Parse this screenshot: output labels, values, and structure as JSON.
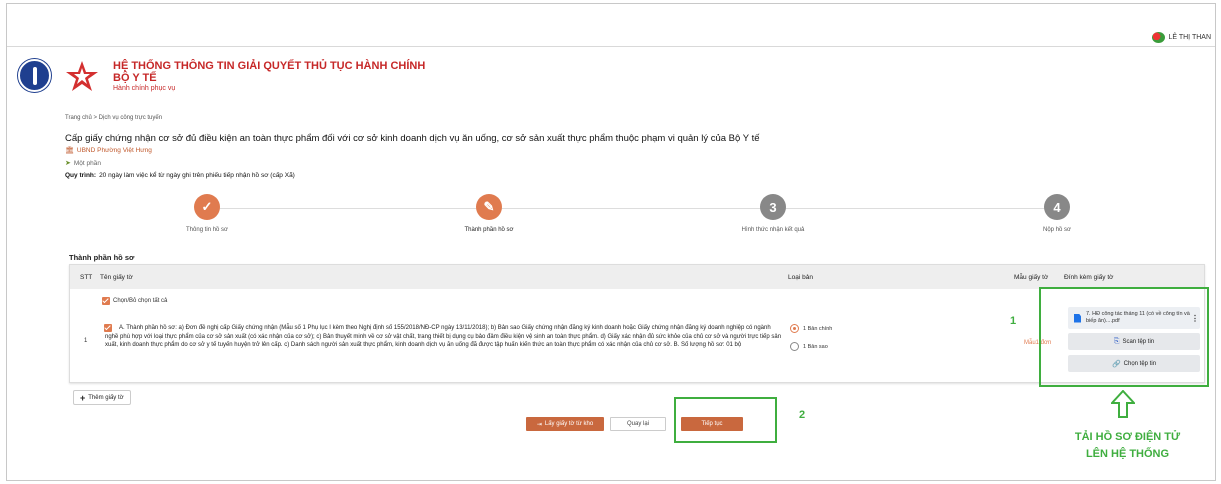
{
  "user": {
    "name": "LÊ THỊ THAN"
  },
  "brand": {
    "title_line1": "HỆ THỐNG THÔNG TIN GIẢI QUYẾT THỦ TỤC HÀNH CHÍNH",
    "title_line2": "BỘ Y TẾ",
    "subtitle": "Hành chính phục vụ"
  },
  "breadcrumb": {
    "home": "Trang chủ",
    "separator": ">",
    "current": "Dịch vụ công trực tuyến"
  },
  "procedure": {
    "title": "Cấp giấy chứng nhận cơ sở đủ điều kiện an toàn thực phẩm đối với cơ sở kinh doanh dịch vụ ăn uống, cơ sở sản xuất thực phẩm thuộc phạm vi quản lý của Bộ Y tế",
    "org": "UBND Phường Việt Hưng",
    "level": "Một phần",
    "process_label": "Quy trình:",
    "process_value": "20 ngày làm việc kể từ ngày ghi trên phiếu tiếp nhận hồ sơ (cấp Xã)"
  },
  "steps": [
    {
      "number": "✓",
      "label": "Thông tin hồ sơ",
      "state": "done"
    },
    {
      "number": "✎",
      "label": "Thành phần hồ sơ",
      "state": "active"
    },
    {
      "number": "3",
      "label": "Hình thức nhận kết quả",
      "state": "todo"
    },
    {
      "number": "4",
      "label": "Nộp hồ sơ",
      "state": "todo"
    }
  ],
  "section": {
    "title": "Thành phần hồ sơ"
  },
  "table": {
    "headers": {
      "stt": "STT",
      "name": "Tên giấy tờ",
      "type": "Loại bản",
      "template": "Mẫu giấy tờ",
      "attach": "Đính kèm giấy tờ"
    },
    "select_all": "Chọn/Bỏ chọn tất cả",
    "row": {
      "stt": "1",
      "text": "A. Thành phần hồ sơ: a) Đơn đề nghị cấp Giấy chứng nhận (Mẫu số 1 Phụ lục I kèm theo Nghị định số 155/2018/NĐ-CP ngày 13/11/2018); b) Bản sao Giấy chứng nhận đăng ký kinh doanh hoặc Giấy chứng nhận đăng ký doanh nghiệp có ngành nghề phù hợp với loại thực phẩm của cơ sở sản xuất (có xác nhận của cơ sở); c) Bản thuyết minh về cơ sở vật chất, trang thiết bị dụng cụ bảo đảm điều kiện vệ sinh an toàn thực phẩm. d) Giấy xác nhận đủ sức khỏe của chủ cơ sở và người trực tiếp sản xuất, kinh doanh thực phẩm do cơ sở y tế tuyến huyện trở lên cấp. c) Danh sách người sản xuất thực phẩm, kinh doanh dịch vụ ăn uống đã được tập huấn kiến thức an toàn thực phẩm có xác nhận của chủ cơ sở. B. Số lượng hồ sơ: 01 bộ",
      "type_options": [
        "1 Bản chính",
        "1 Bản sao"
      ],
      "template_link": "Mẫu1 đơn",
      "file_name": "7. HĐ công tác tháng 11 (có về công tín và biếp ăn)....pdf",
      "scan_button": "Scan tệp tin",
      "choose_button": "Chọn tệp tin"
    }
  },
  "actions": {
    "add_doc": "Thêm giấy tờ",
    "get_from_repo": "Lấy giấy tờ từ kho",
    "back": "Quay lại",
    "continue": "Tiếp tục"
  },
  "annotations": {
    "num1": "1",
    "num2": "2",
    "upload_text_line1": "TẢI HỒ SƠ ĐIỆN TỬ",
    "upload_text_line2": "LÊN HỆ THỐNG",
    "color": "#3fae3f"
  },
  "colors": {
    "brand_red": "#c62828",
    "accent_orange": "#e07b4f",
    "button_brown": "#c9683e"
  }
}
